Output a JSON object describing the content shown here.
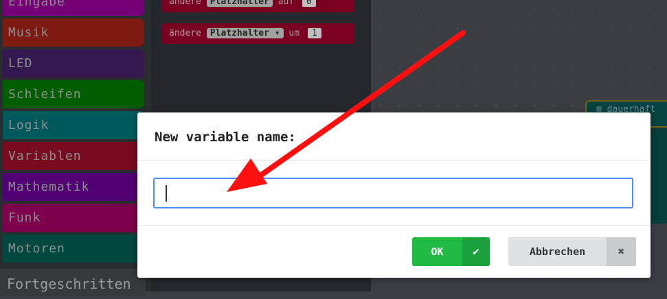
{
  "toolbox": {
    "categories": [
      {
        "label": "Eingabe",
        "color": "#d400d4"
      },
      {
        "label": "Musik",
        "color": "#e63022"
      },
      {
        "label": "LED",
        "color": "#5c2d91"
      },
      {
        "label": "Schleifen",
        "color": "#00aa00"
      },
      {
        "label": "Logik",
        "color": "#00a4a6"
      },
      {
        "label": "Variablen",
        "color": "#dc143c"
      },
      {
        "label": "Mathematik",
        "color": "#9400d3"
      },
      {
        "label": "Funk",
        "color": "#e3008c"
      },
      {
        "label": "Motoren",
        "color": "#008272"
      }
    ],
    "advanced_label": "Fortgeschritten"
  },
  "flyout": {
    "block1": {
      "prefix": "ändere",
      "var": "Platzhalter",
      "op": "auf",
      "value": "0"
    },
    "block2": {
      "prefix": "ändere",
      "var": "Platzhalter ▾",
      "op": "um",
      "value": "1"
    }
  },
  "workspace": {
    "block_label": "dauerhaft"
  },
  "dialog": {
    "title": "New variable name:",
    "input_value": "",
    "ok_label": "OK",
    "ok_icon": "✔",
    "cancel_label": "Abbrechen",
    "cancel_icon": "✖"
  },
  "colors": {
    "ok_green": "#21ba45",
    "input_border": "#4c8df6",
    "annotation_arrow": "#ff0000"
  }
}
